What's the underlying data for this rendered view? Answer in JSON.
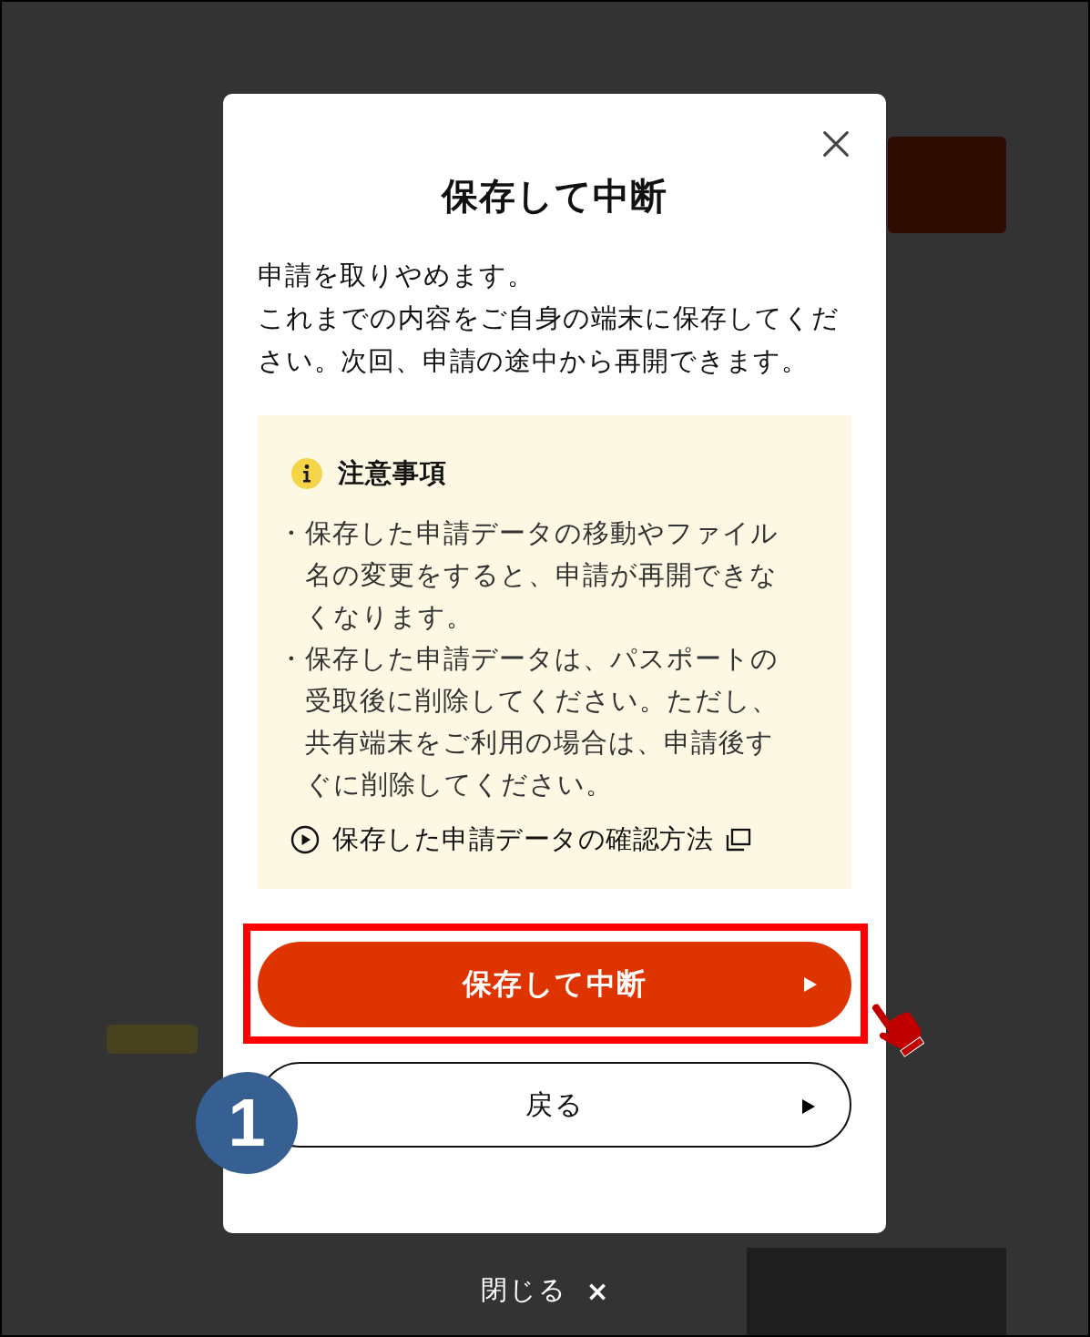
{
  "dialog": {
    "title": "保存して中断",
    "description": [
      "申請を取りやめます。",
      "これまでの内容をご自身の端末に保存してください。次回、申請の途中から再開できます。"
    ],
    "notice": {
      "heading": "注意事項",
      "items": [
        "・保存した申請データの移動やファイル名の変更をすると、申請が再開できなくなります。",
        "・保存した申請データは、パスポートの受取後に削除してください。ただし、共有端末をご利用の場合は、申請後すぐに削除してください。"
      ],
      "link": "保存した申請データの確認方法"
    },
    "buttons": [
      {
        "label": "保存して中断",
        "kind": "primary",
        "highlighted": true
      },
      {
        "label": "戻る",
        "kind": "secondary",
        "highlighted": false
      }
    ]
  },
  "step_badge": "1",
  "close_label": "閉じる",
  "close_mark": "×"
}
